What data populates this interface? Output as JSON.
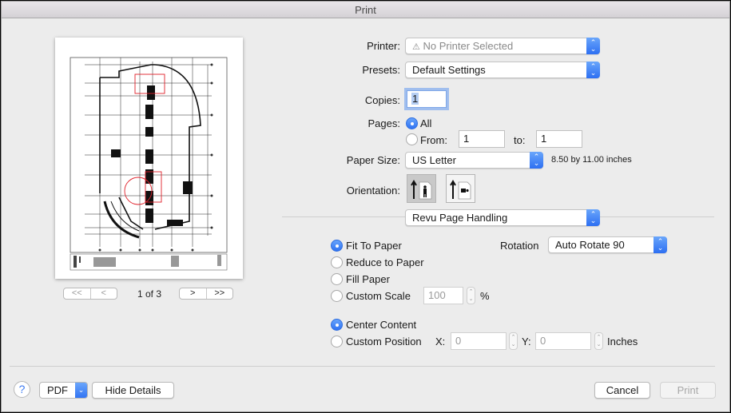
{
  "window": {
    "title": "Print"
  },
  "preview": {
    "page_indicator": "1 of 3",
    "nav": {
      "first": "<<",
      "prev": "<",
      "next": ">",
      "last": ">>"
    }
  },
  "printer": {
    "label": "Printer:",
    "value": "No Printer Selected",
    "warning_icon": "⚠"
  },
  "presets": {
    "label": "Presets:",
    "value": "Default Settings"
  },
  "copies": {
    "label": "Copies:",
    "value": "1"
  },
  "pages": {
    "label": "Pages:",
    "all_label": "All",
    "from_label": "From:",
    "from_value": "1",
    "to_label": "to:",
    "to_value": "1",
    "selected": "All"
  },
  "paper_size": {
    "label": "Paper Size:",
    "value": "US Letter",
    "dimensions": "8.50 by 11.00 inches"
  },
  "orientation": {
    "label": "Orientation:",
    "selected": "portrait"
  },
  "section_popup": {
    "value": "Revu Page Handling"
  },
  "scaling": {
    "options": [
      "Fit To Paper",
      "Reduce to Paper",
      "Fill Paper",
      "Custom Scale"
    ],
    "selected": "Fit To Paper",
    "custom_scale_value": "100",
    "percent_label": "%"
  },
  "rotation": {
    "label": "Rotation",
    "value": "Auto Rotate 90"
  },
  "position": {
    "options": [
      "Center Content",
      "Custom Position"
    ],
    "selected": "Center Content",
    "x_label": "X:",
    "x_value": "0",
    "y_label": "Y:",
    "y_value": "0",
    "units_label": "Inches"
  },
  "footer": {
    "help": "?",
    "pdf_label": "PDF",
    "hide_details": "Hide Details",
    "cancel": "Cancel",
    "print": "Print"
  },
  "colors": {
    "accent": "#2f72f3",
    "markup_red": "#e0202a"
  }
}
